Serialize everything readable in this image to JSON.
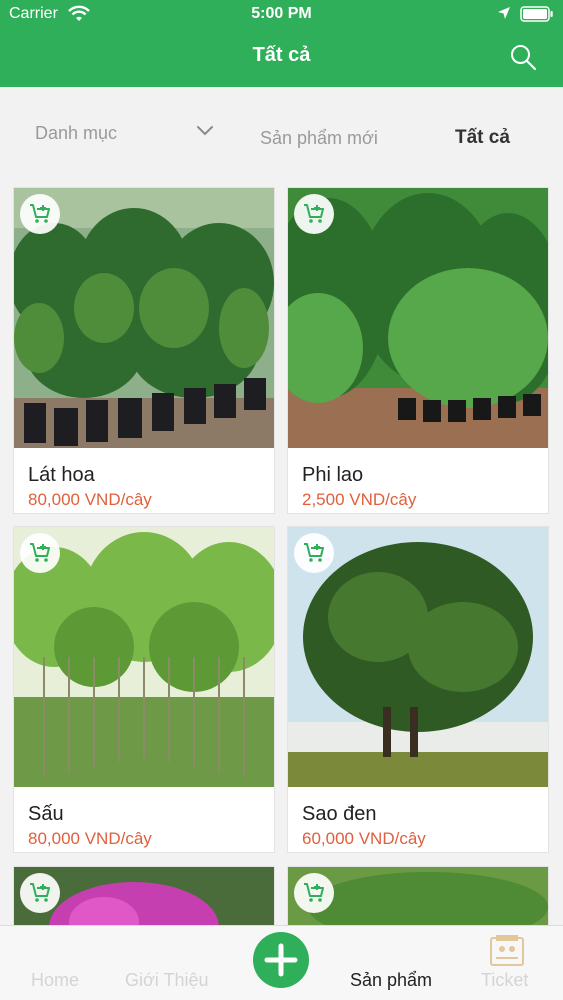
{
  "status_bar": {
    "carrier": "Carrier",
    "time": "5:00 PM"
  },
  "header": {
    "title": "Tất cả"
  },
  "filter": {
    "category": "Danh mục",
    "tab_new": "Sản phẩm mới",
    "tab_all": "Tất cả"
  },
  "products": [
    {
      "name": "Lát hoa",
      "price": "80,000 VND/cây"
    },
    {
      "name": "Phi lao",
      "price": "2,500 VND/cây"
    },
    {
      "name": "Sấu",
      "price": "80,000 VND/cây"
    },
    {
      "name": "Sao đen",
      "price": "60,000 VND/cây"
    },
    {
      "name": "",
      "price": ""
    },
    {
      "name": "",
      "price": ""
    }
  ],
  "tabbar": {
    "home": "Home",
    "about": "Giới Thiệu",
    "products": "Sản phẩm",
    "ticket": "Ticket"
  },
  "colors": {
    "brand": "#2faf5a",
    "price": "#e0603c"
  },
  "icons": [
    "wifi-icon",
    "location-arrow-icon",
    "battery-icon",
    "search-icon",
    "chevron-down-icon",
    "add-to-cart-icon",
    "plus-icon",
    "ticket-icon"
  ]
}
